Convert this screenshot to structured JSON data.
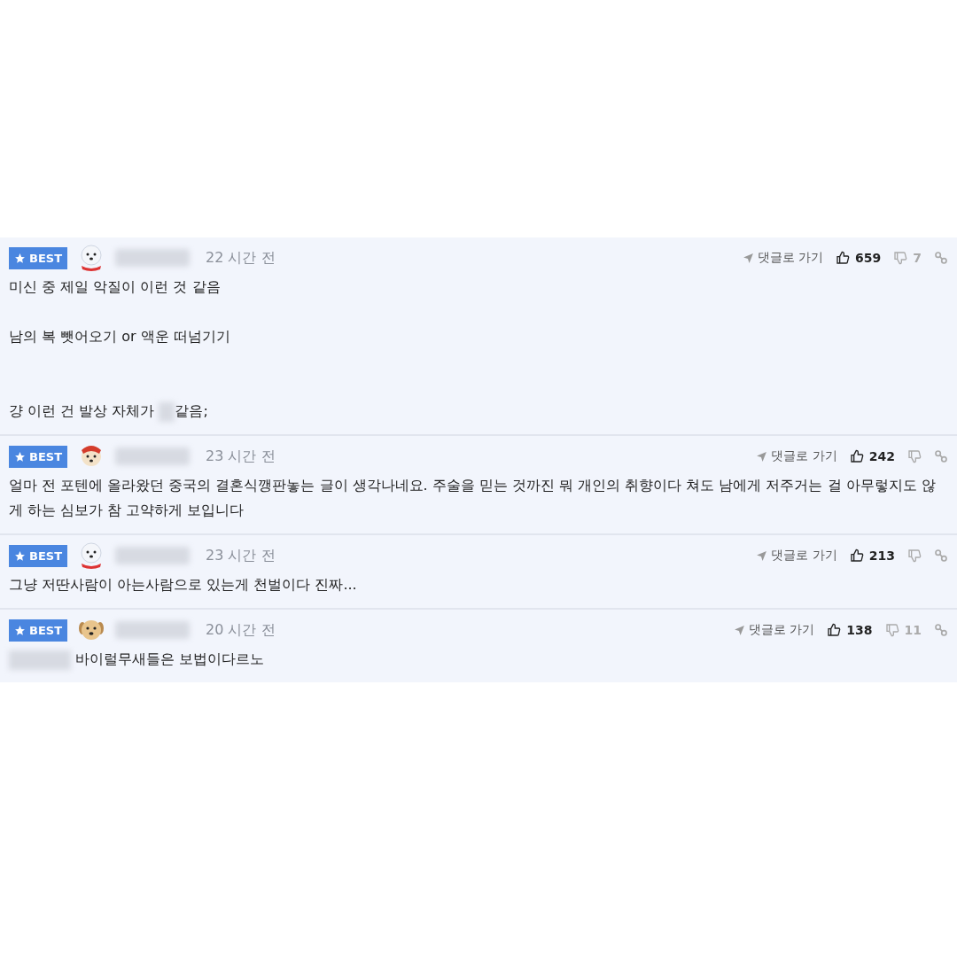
{
  "comments": [
    {
      "badge": "BEST",
      "avatar": {
        "kind": "bear"
      },
      "time": "22 시간 전",
      "goto": "댓글로 가기",
      "likes": "659",
      "dislikes": "7",
      "body": [
        {
          "kind": "line",
          "segments": [
            {
              "kind": "text",
              "text": "미신 중 제일 악질이 이런 것 같음"
            }
          ]
        },
        {
          "kind": "blank"
        },
        {
          "kind": "line",
          "segments": [
            {
              "kind": "text",
              "text": "남의 복 뺏어오기 or 액운 떠넘기기"
            }
          ]
        },
        {
          "kind": "blank"
        },
        {
          "kind": "blank"
        },
        {
          "kind": "line",
          "segments": [
            {
              "kind": "text",
              "text": "걍 이런 건 발상 자체가 "
            },
            {
              "kind": "redacted"
            },
            {
              "kind": "text",
              "text": "같음;"
            }
          ]
        }
      ]
    },
    {
      "badge": "BEST",
      "avatar": {
        "kind": "dog"
      },
      "time": "23 시간 전",
      "goto": "댓글로 가기",
      "likes": "242",
      "body": [
        {
          "kind": "line",
          "segments": [
            {
              "kind": "text",
              "text": "얼마 전 포텐에 올라왔던 중국의 결혼식깽판놓는 글이 생각나네요. 주술을 믿는 것까진 뭐 개인의 취향이다 쳐도 남에게 저주거는 걸 아무렇지도 않게 하는 심보가 참 고약하게 보입니다"
            }
          ]
        }
      ]
    },
    {
      "badge": "BEST",
      "avatar": {
        "kind": "bear"
      },
      "time": "23 시간 전",
      "goto": "댓글로 가기",
      "likes": "213",
      "body": [
        {
          "kind": "line",
          "segments": [
            {
              "kind": "text",
              "text": "그냥 저딴사람이 아는사람으로 있는게 천벌이다 진짜..."
            }
          ]
        }
      ]
    },
    {
      "badge": "BEST",
      "avatar": {
        "kind": "puppy"
      },
      "time": "20 시간 전",
      "goto": "댓글로 가기",
      "likes": "138",
      "dislikes": "11",
      "body": [
        {
          "kind": "line",
          "segments": [
            {
              "kind": "redacted"
            },
            {
              "kind": "text",
              "text": " 바이럴무새들은 보법이다르노"
            }
          ]
        }
      ]
    }
  ]
}
